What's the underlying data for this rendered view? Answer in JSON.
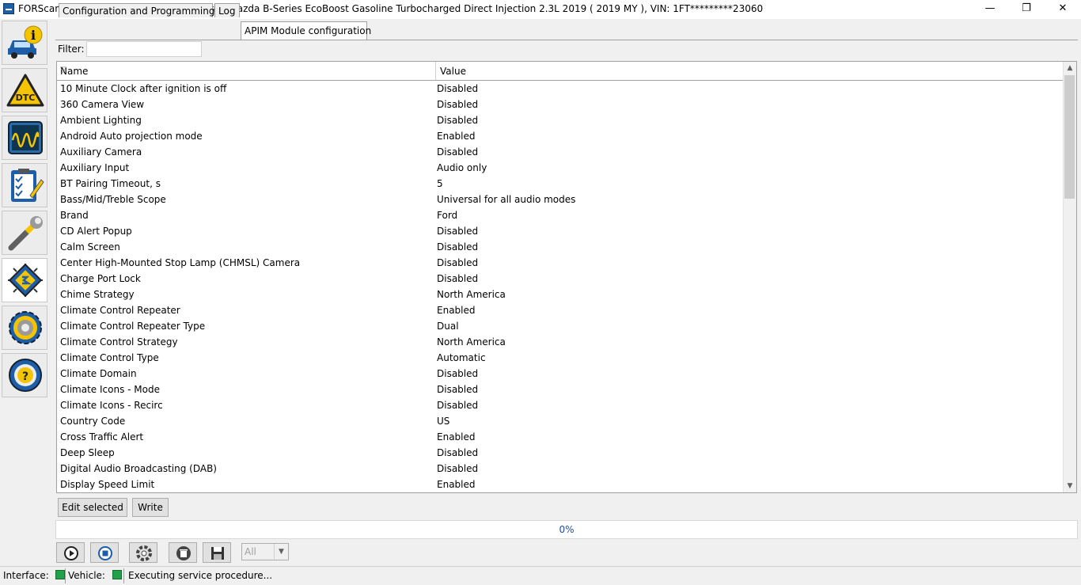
{
  "window": {
    "title": "FORScan v2.3.34 beta, Ford Ranger/Courier/Mazda B-Series EcoBoost Gasoline Turbocharged Direct Injection 2.3L 2019 ( 2019 MY ), VIN: 1FT*********23060",
    "minimize": "—",
    "maximize": "❐",
    "close": "✕"
  },
  "sidebar": {
    "items": [
      {
        "icon": "vehicle-info-icon"
      },
      {
        "icon": "dtc-warning-icon"
      },
      {
        "icon": "oscilloscope-icon"
      },
      {
        "icon": "checklist-icon"
      },
      {
        "icon": "wrench-icon"
      },
      {
        "icon": "chip-config-icon"
      },
      {
        "icon": "settings-gear-icon"
      },
      {
        "icon": "help-wheel-icon"
      }
    ],
    "active_index": 5
  },
  "tabs": [
    {
      "label": "Configuration and Programming"
    },
    {
      "label": "Log"
    },
    {
      "label": "APIM Module configuration"
    }
  ],
  "filter": {
    "label": "Filter:",
    "value": ""
  },
  "grid": {
    "columns": {
      "name": "Name",
      "value": "Value"
    },
    "rows": [
      {
        "name": "10 Minute Clock after ignition is off",
        "value": "Disabled"
      },
      {
        "name": "360 Camera View",
        "value": "Disabled"
      },
      {
        "name": "Ambient Lighting",
        "value": "Disabled"
      },
      {
        "name": "Android Auto projection mode",
        "value": "Enabled"
      },
      {
        "name": "Auxiliary Camera",
        "value": "Disabled"
      },
      {
        "name": "Auxiliary Input",
        "value": "Audio only"
      },
      {
        "name": "BT Pairing Timeout, s",
        "value": "5"
      },
      {
        "name": "Bass/Mid/Treble Scope",
        "value": "Universal for all audio modes"
      },
      {
        "name": "Brand",
        "value": "Ford"
      },
      {
        "name": "CD Alert Popup",
        "value": "Disabled"
      },
      {
        "name": "Calm Screen",
        "value": "Disabled"
      },
      {
        "name": "Center High-Mounted Stop Lamp (CHMSL) Camera",
        "value": "Disabled"
      },
      {
        "name": "Charge Port Lock",
        "value": "Disabled"
      },
      {
        "name": "Chime Strategy",
        "value": "North America"
      },
      {
        "name": "Climate Control Repeater",
        "value": "Enabled"
      },
      {
        "name": "Climate Control Repeater Type",
        "value": "Dual"
      },
      {
        "name": "Climate Control Strategy",
        "value": "North America"
      },
      {
        "name": "Climate Control Type",
        "value": "Automatic"
      },
      {
        "name": "Climate Domain",
        "value": "Disabled"
      },
      {
        "name": "Climate Icons - Mode",
        "value": "Disabled"
      },
      {
        "name": "Climate Icons - Recirc",
        "value": "Disabled"
      },
      {
        "name": "Country Code",
        "value": "US"
      },
      {
        "name": "Cross Traffic Alert",
        "value": "Enabled"
      },
      {
        "name": "Deep Sleep",
        "value": "Disabled"
      },
      {
        "name": "Digital Audio Broadcasting (DAB)",
        "value": "Disabled"
      },
      {
        "name": "Display Speed Limit",
        "value": "Enabled"
      }
    ]
  },
  "actions": {
    "edit_selected": "Edit selected",
    "write": "Write"
  },
  "progress": {
    "text": "0%",
    "fraction": 0
  },
  "toolbar": {
    "buttons": [
      {
        "icon": "play-icon"
      },
      {
        "icon": "stop-icon"
      },
      {
        "icon": "lifebuoy-icon"
      },
      {
        "icon": "trash-icon"
      },
      {
        "icon": "save-icon"
      }
    ],
    "select_value": "All"
  },
  "status": {
    "interface_label": "Interface:",
    "vehicle_label": "Vehicle:",
    "message": "Executing service procedure..."
  }
}
